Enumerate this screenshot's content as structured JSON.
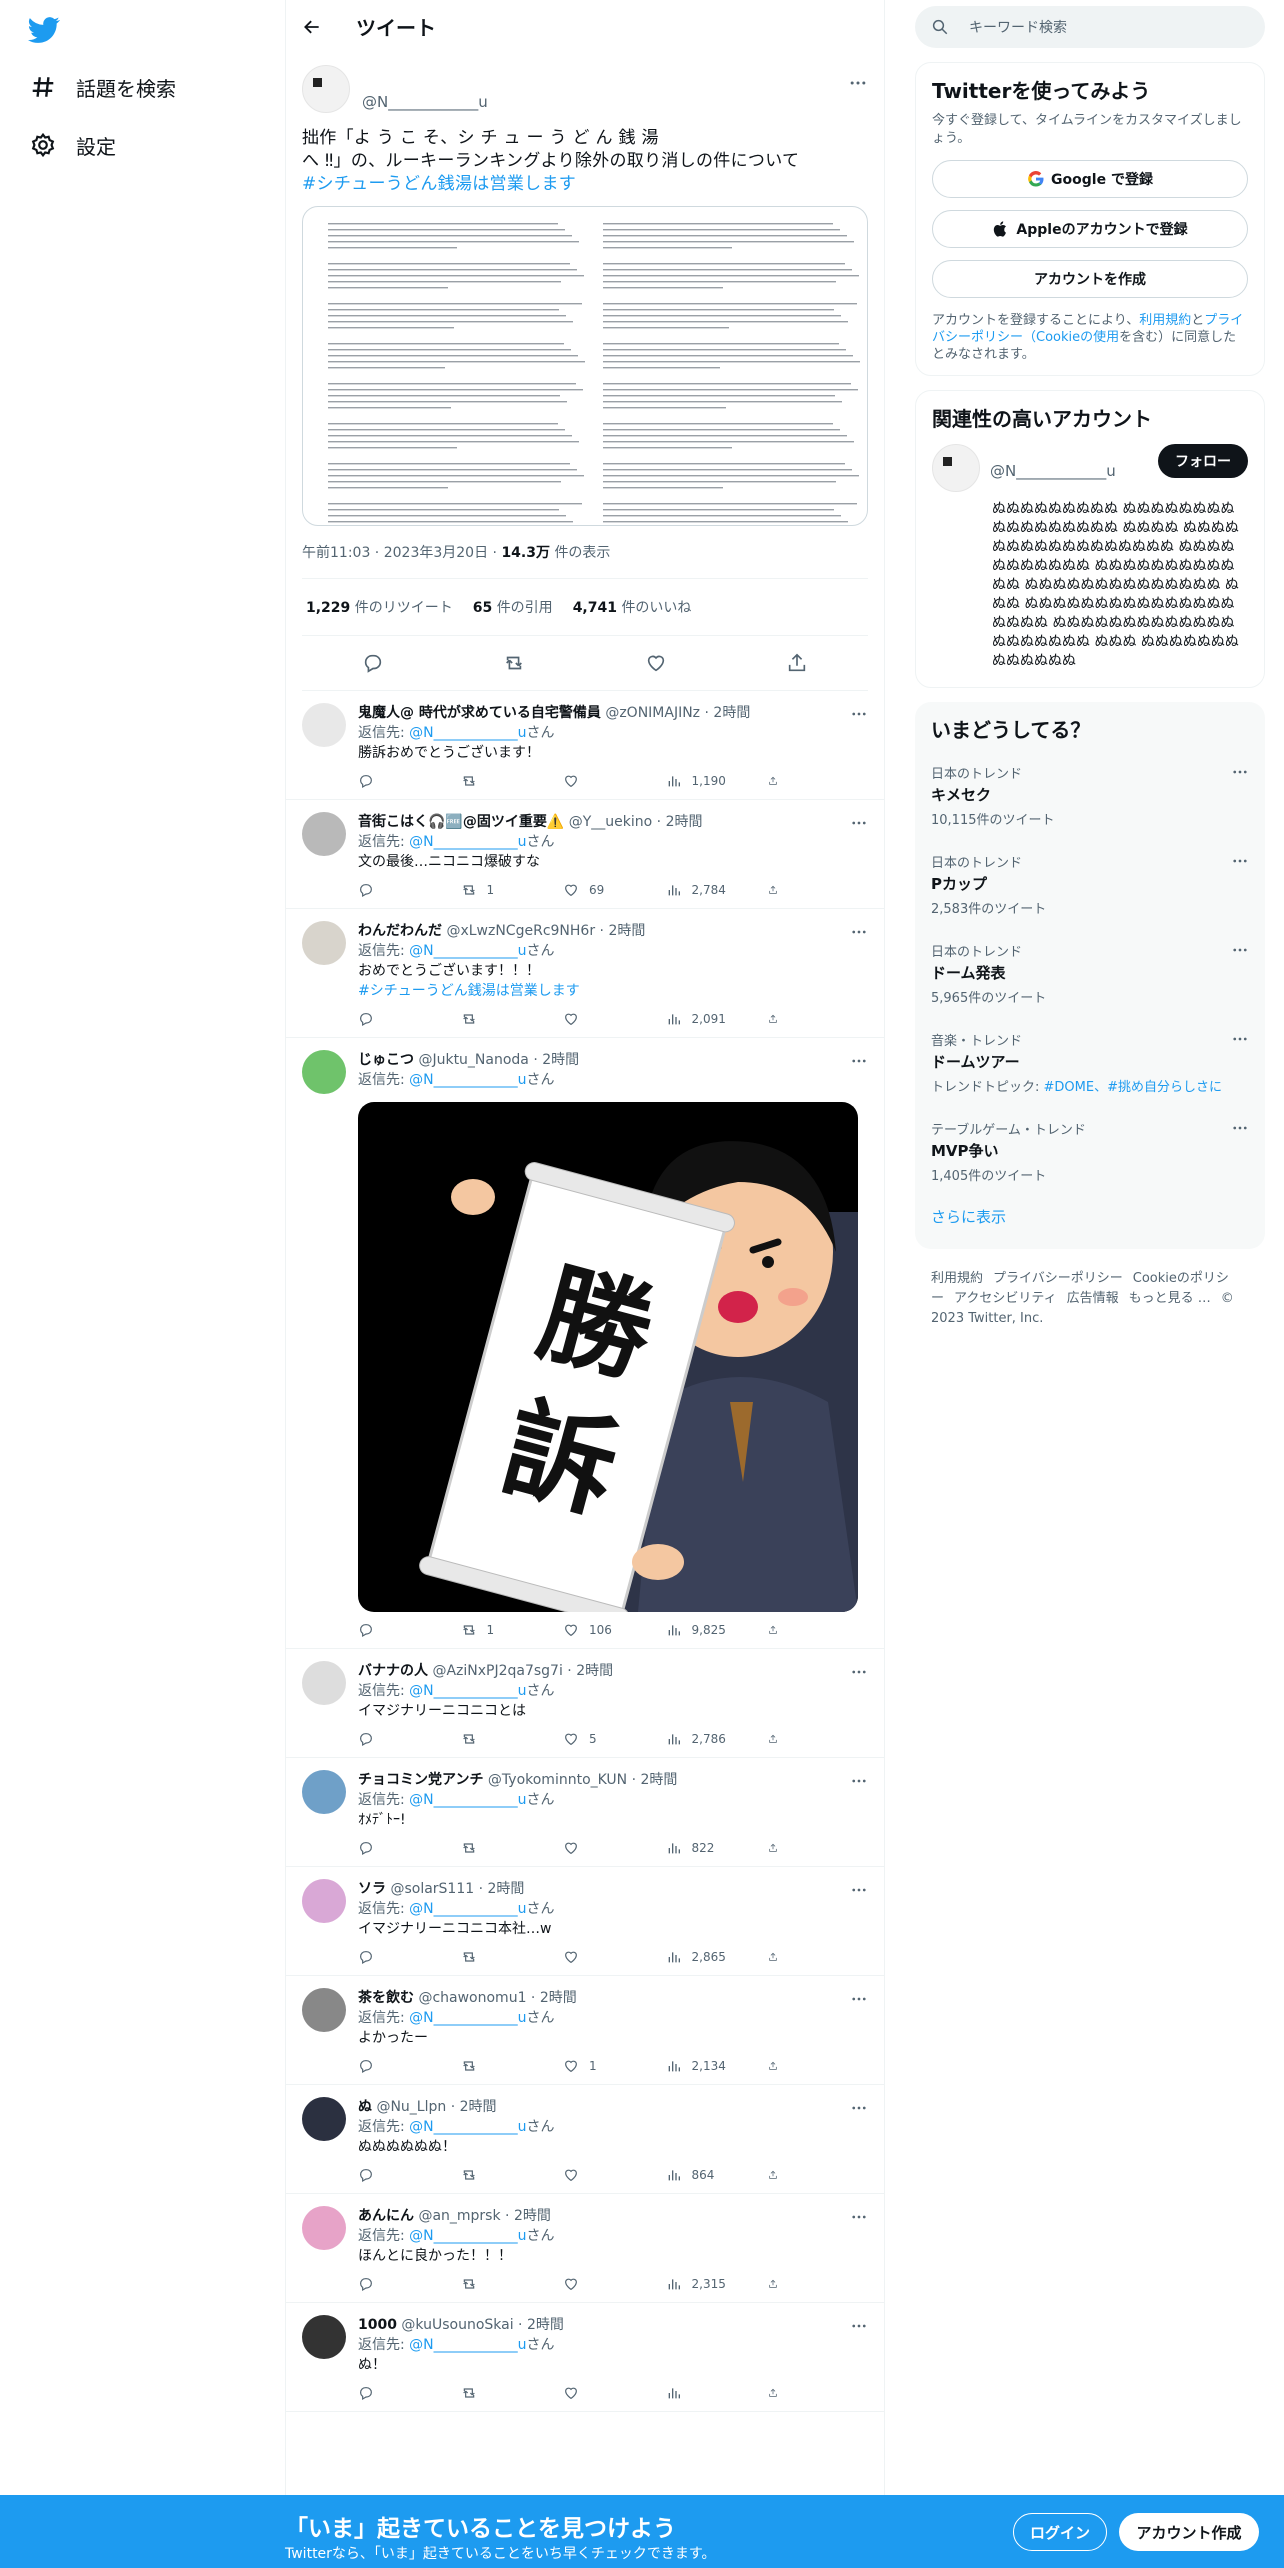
{
  "nav": {
    "explore_label": "話題を検索",
    "settings_label": "設定"
  },
  "header": {
    "title": "ツイート"
  },
  "main_tweet": {
    "handle": "@N____________u",
    "text_line1": "拙作「よ う こ そ、シ チ ュ ー う ど ん 銭 湯",
    "text_line2": "へ ‼」の、ルーキーランキングより除外の取り消しの件について",
    "hashtag": "#シチューうどん銭湯は営業します",
    "time": "午前11:03",
    "date": "2023年3月20日",
    "views_num": "14.3万",
    "views_label": "件の表示",
    "retweets_num": "1,229",
    "retweets_label": "件のリツイート",
    "quotes_num": "65",
    "quotes_label": "件の引用",
    "likes_num": "4,741",
    "likes_label": "件のいいね"
  },
  "reply_to_label": "返信先:",
  "reply_to_handle": "@N____________u",
  "reply_to_suffix": "さん",
  "replies": [
    {
      "name": "鬼魔人@ 時代が求めている自宅警備員",
      "handle": "@zONIMAJINz",
      "time": "2時間",
      "text": "勝訴おめでとうございます！",
      "rt": "",
      "like": "",
      "views": "1,190",
      "avatar_color": "#e8e8e8"
    },
    {
      "name": "音街こはく🎧🆓@固ツイ重要⚠️",
      "handle": "@Y__uekino",
      "time": "2時間",
      "text": "文の最後…ニコニコ爆破すな",
      "rt": "1",
      "like": "69",
      "views": "2,784",
      "avatar_color": "#b9b9b9"
    },
    {
      "name": "わんだわんだ",
      "handle": "@xLwzNCgeRc9NH6r",
      "time": "2時間",
      "text": "おめでとうございます！！！",
      "hashtag": "#シチューうどん銭湯は営業します",
      "rt": "",
      "like": "",
      "views": "2,091",
      "avatar_color": "#d8d4cc"
    },
    {
      "name": "じゅこつ",
      "handle": "@Juktu_Nanoda",
      "time": "2時間",
      "text": "",
      "rt": "1",
      "like": "106",
      "views": "9,825",
      "avatar_color": "#6fc36b"
    },
    {
      "name": "バナナの人",
      "handle": "@AziNxPJ2qa7sg7i",
      "time": "2時間",
      "text": "イマジナリーニコニコとは",
      "rt": "",
      "like": "5",
      "views": "2,786",
      "avatar_color": "#dddddd"
    },
    {
      "name": "チョコミン党アンチ",
      "handle": "@Tyokominnto_KUN",
      "time": "2時間",
      "text": "ｵﾒﾃﾞﾄｰ!",
      "rt": "",
      "like": "",
      "views": "822",
      "avatar_color": "#6fa0c8"
    },
    {
      "name": "ソラ",
      "handle": "@solarS111",
      "time": "2時間",
      "text": "イマジナリーニコニコ本社…w",
      "rt": "",
      "like": "",
      "views": "2,865",
      "avatar_color": "#d9a8d6"
    },
    {
      "name": "茶を飲む",
      "handle": "@chawonomu1",
      "time": "2時間",
      "text": "よかったー",
      "rt": "",
      "like": "1",
      "views": "2,134",
      "avatar_color": "#888888"
    },
    {
      "name": "ぬ",
      "handle": "@Nu_Llpn",
      "time": "2時間",
      "text": "ぬぬぬぬぬぬ！",
      "rt": "",
      "like": "",
      "views": "864",
      "avatar_color": "#2b3040"
    },
    {
      "name": "あんにん",
      "handle": "@an_mprsk",
      "time": "2時間",
      "text": "ほんとに良かった！！！",
      "rt": "",
      "like": "",
      "views": "2,315",
      "avatar_color": "#e7a3c8"
    },
    {
      "name": "1000",
      "handle": "@kuUsounoSkai",
      "time": "2時間",
      "text": "ぬ！",
      "rt": "",
      "like": "",
      "views": "",
      "avatar_color": "#333333"
    }
  ],
  "image_text": "勝訴",
  "right": {
    "search_placeholder": "キーワード検索",
    "signup_title": "Twitterを使ってみよう",
    "signup_sub": "今すぐ登録して、タイムラインをカスタマイズしましょう。",
    "google_btn": "Google で登録",
    "apple_btn": "Appleのアカウントで登録",
    "create_btn": "アカウントを作成",
    "legal_pre": "アカウントを登録することにより、",
    "legal_terms": "利用規約",
    "legal_and": "と",
    "legal_privacy": "プライバシーポリシー（Cookieの使用",
    "legal_post": "を含む）に同意したとみなされます。",
    "rec_title": "関連性の高いアカウント",
    "rec_handle": "@N____________u",
    "follow": "フォロー",
    "rec_bio": "ぬぬぬぬぬぬぬぬぬ ぬぬぬぬぬぬぬぬ ぬぬぬぬぬぬぬぬぬ ぬぬぬぬ ぬぬぬぬぬぬぬぬぬぬぬぬぬぬぬぬぬ ぬぬぬぬぬぬぬぬぬぬぬ ぬぬぬぬぬぬぬぬぬぬぬぬ ぬぬぬぬぬぬぬぬぬぬぬぬぬぬ ぬぬぬ ぬぬぬぬぬぬぬぬぬぬぬぬぬぬぬぬぬぬぬ ぬぬぬぬぬぬぬぬぬぬぬぬぬぬぬぬぬぬぬぬ ぬぬぬ ぬぬぬぬぬぬぬぬぬぬぬぬぬ",
    "trends_title": "いまどうしてる？",
    "trends": [
      {
        "ctx": "日本のトレンド",
        "name": "キメセク",
        "count": "10,115件のツイート"
      },
      {
        "ctx": "日本のトレンド",
        "name": "Pカップ",
        "count": "2,583件のツイート"
      },
      {
        "ctx": "日本のトレンド",
        "name": "ドーム発表",
        "count": "5,965件のツイート"
      },
      {
        "ctx": "音楽・トレンド",
        "name": "ドームツアー",
        "count_pre": "トレンドトピック: ",
        "count_tags": "#DOME、#挑め自分らしさに"
      },
      {
        "ctx": "テーブルゲーム・トレンド",
        "name": "MVP争い",
        "count": "1,405件のツイート"
      }
    ],
    "show_more": "さらに表示",
    "footer": [
      "利用規約",
      "プライバシーポリシー",
      "Cookieのポリシー",
      "アクセシビリティ",
      "広告情報",
      "もっと見る …",
      "© 2023 Twitter, Inc."
    ]
  },
  "bottom": {
    "headline": "「いま」起きていることを見つけよう",
    "sub": "Twitterなら、「いま」起きていることをいち早くチェックできます。",
    "login": "ログイン",
    "signup": "アカウント作成"
  },
  "colors": {
    "accent": "#1d9bf0",
    "text": "#0f1419",
    "muted": "#536471"
  }
}
